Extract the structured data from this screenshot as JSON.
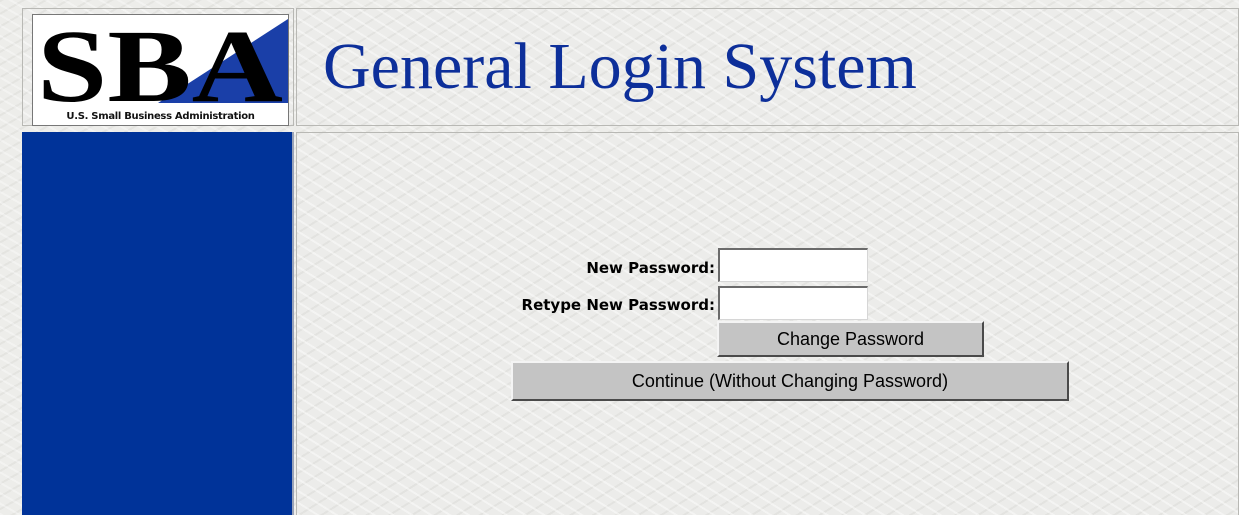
{
  "header": {
    "logo": {
      "text": "SBA",
      "subtitle": "U.S. Small Business Administration"
    },
    "title": "General Login System"
  },
  "form": {
    "new_password": {
      "label": "New Password:",
      "value": ""
    },
    "retype_password": {
      "label": "Retype New Password:",
      "value": ""
    },
    "change_button": "Change Password",
    "continue_button": "Continue (Without Changing Password)"
  },
  "colors": {
    "title": "#0d2f9a",
    "sidebar": "#003399",
    "logo_triangle": "#1a3fa8",
    "button": "#c4c4c4"
  }
}
